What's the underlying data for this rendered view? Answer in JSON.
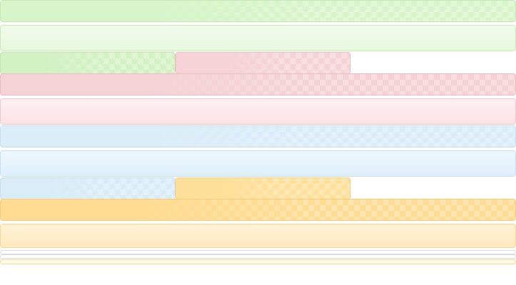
{
  "themes": {
    "green": {
      "header_label": "",
      "body_label": "",
      "tab_active_label": "",
      "accent": "#d7f5c8"
    },
    "red": {
      "tab_label": "",
      "header_label": "",
      "body_label": "",
      "accent": "#f5d2d5"
    },
    "blue": {
      "header_label": "",
      "body_label": "",
      "tab_label": "",
      "accent": "#daedf8"
    },
    "orange": {
      "tab_label": "",
      "header_label": "",
      "body_label": "",
      "accent": "#ffdc91"
    }
  },
  "strips": {
    "strip_1": "",
    "strip_2": "",
    "strip_3": ""
  }
}
